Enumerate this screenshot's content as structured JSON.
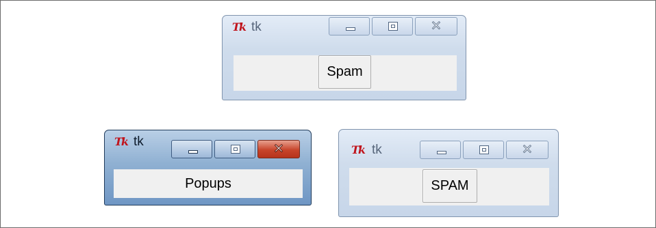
{
  "windows": [
    {
      "title": "tk",
      "button_label": "Spam"
    },
    {
      "title": "tk",
      "button_label": "Popups"
    },
    {
      "title": "tk",
      "button_label": "SPAM"
    }
  ],
  "logo_text": "Tk"
}
